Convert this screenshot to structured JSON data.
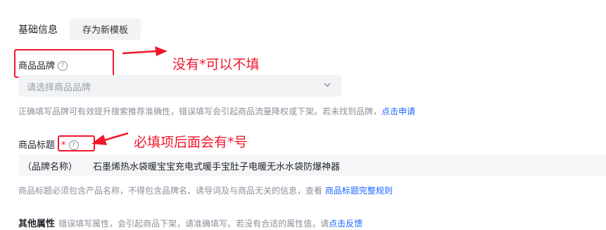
{
  "section": {
    "title": "基础信息",
    "save_template_label": "存为新模板"
  },
  "brand": {
    "label": "商品品牌",
    "select_placeholder": "请选择商品品牌",
    "hint": "正确填写品牌可有效提升搜索推荐准确性，错误填写会引起商品流量降权或下架。若未找到品牌，",
    "hint_link": "点击申请"
  },
  "title_field": {
    "label": "商品标题",
    "required_mark": "*",
    "input_prefix": "（品牌名称）",
    "input_value": "石墨烯热水袋暖宝宝充电式暖手宝肚子电暖无水水袋防爆神器",
    "hint": "商品标题必须包含产品名称，不得包含品牌名、诱导词及与商品无关的信息，查看",
    "hint_link": "商品标题完整规则"
  },
  "other_attributes": {
    "label": "其他属性",
    "hint": "错误填写属性，会引起商品下架，请准确填写。若没有合适的属性值，请",
    "hint_link": "点击反馈"
  },
  "annotations": {
    "optional_note": "没有*可以不填",
    "required_note": "必填项后面会有*号"
  },
  "icons": {
    "help": "question-circle-icon",
    "dropdown": "chevron-down-icon"
  },
  "colors": {
    "annotation_red": "#f2162b",
    "link_blue": "#1966ff"
  }
}
